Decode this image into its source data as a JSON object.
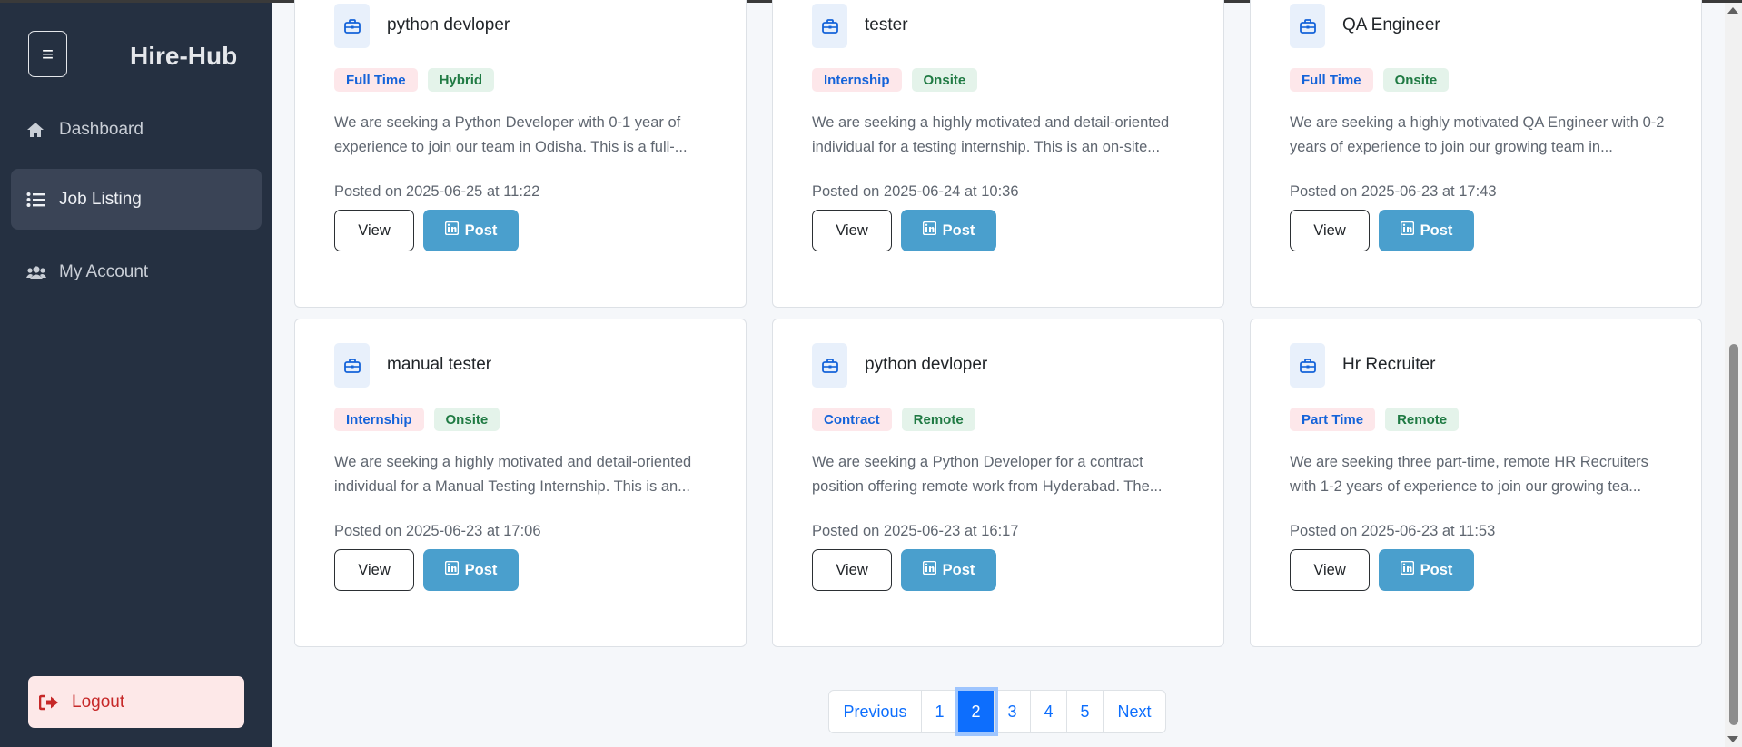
{
  "app": {
    "brand": "Hire-Hub"
  },
  "sidebar": {
    "items": [
      {
        "label": "Dashboard",
        "icon": "home-icon",
        "active": false
      },
      {
        "label": "Job Listing",
        "icon": "list-icon",
        "active": true
      },
      {
        "label": "My Account",
        "icon": "users-icon",
        "active": false
      }
    ],
    "logout_label": "Logout"
  },
  "jobs": [
    {
      "title": "python devloper",
      "type": "Full Time",
      "mode": "Hybrid",
      "description": "We are seeking a Python Developer with 0-1 year of experience to join our team in Odisha. This is a full-...",
      "posted": "Posted on 2025-06-25 at 11:22"
    },
    {
      "title": "tester",
      "type": "Internship",
      "mode": "Onsite",
      "description": "We are seeking a highly motivated and detail-oriented individual for a testing internship. This is an on-site...",
      "posted": "Posted on 2025-06-24 at 10:36"
    },
    {
      "title": "QA Engineer",
      "type": "Full Time",
      "mode": "Onsite",
      "description": "We are seeking a highly motivated QA Engineer with 0-2 years of experience to join our growing team in...",
      "posted": "Posted on 2025-06-23 at 17:43"
    },
    {
      "title": "manual tester",
      "type": "Internship",
      "mode": "Onsite",
      "description": "We are seeking a highly motivated and detail-oriented individual for a Manual Testing Internship. This is an...",
      "posted": "Posted on 2025-06-23 at 17:06"
    },
    {
      "title": "python devloper",
      "type": "Contract",
      "mode": "Remote",
      "description": "We are seeking a Python Developer for a contract position offering remote work from Hyderabad. The...",
      "posted": "Posted on 2025-06-23 at 16:17"
    },
    {
      "title": "Hr Recruiter",
      "type": "Part Time",
      "mode": "Remote",
      "description": "We are seeking three part-time, remote HR Recruiters with 1-2 years of experience to join our growing tea...",
      "posted": "Posted on 2025-06-23 at 11:53"
    }
  ],
  "card_buttons": {
    "view_label": "View",
    "post_label": "Post",
    "post_icon": "linkedin-icon"
  },
  "pagination": {
    "previous_label": "Previous",
    "next_label": "Next",
    "pages": [
      "1",
      "2",
      "3",
      "4",
      "5"
    ],
    "current": "2"
  },
  "colors": {
    "sidebar_bg": "#253041",
    "primary": "#0d6efd",
    "post_button": "#4a9fcd",
    "logout_bg": "#fde8e8",
    "logout_text": "#c62828"
  }
}
